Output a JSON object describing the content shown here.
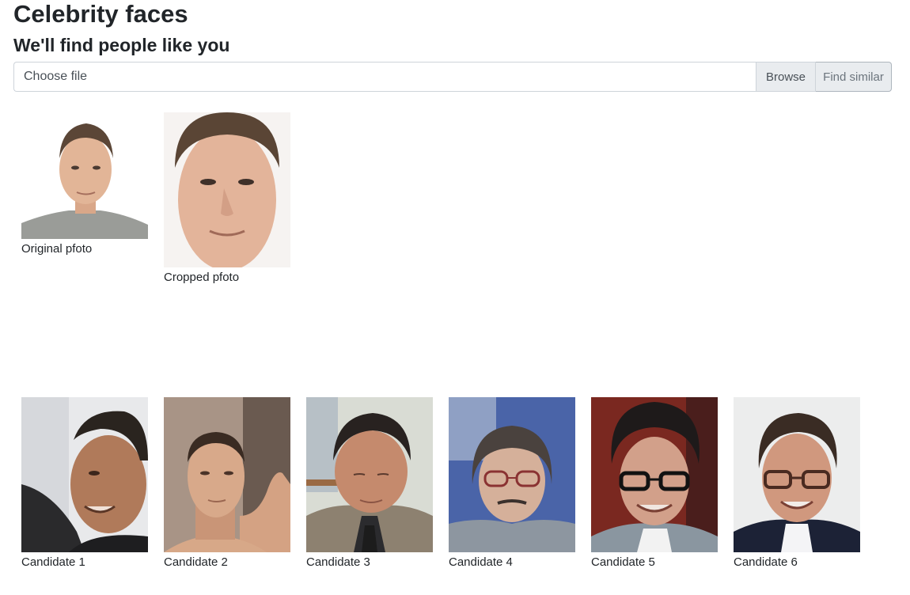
{
  "header": {
    "title": "Celebrity faces",
    "subtitle": "We'll find people like you"
  },
  "upload": {
    "placeholder": "Choose file",
    "browse_label": "Browse",
    "find_label": "Find similar"
  },
  "source": {
    "original_caption": "Original pfoto",
    "cropped_caption": "Cropped pfoto"
  },
  "candidates": [
    {
      "caption": "Candidate 1"
    },
    {
      "caption": "Candidate 2"
    },
    {
      "caption": "Candidate 3"
    },
    {
      "caption": "Candidate 4"
    },
    {
      "caption": "Candidate 5"
    },
    {
      "caption": "Candidate 6"
    }
  ]
}
